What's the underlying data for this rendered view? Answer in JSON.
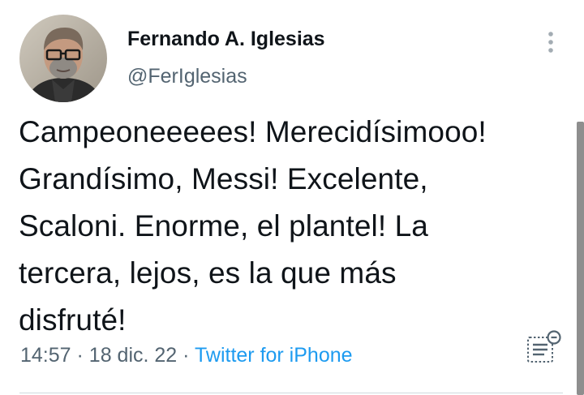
{
  "tweet": {
    "author": {
      "display_name": "Fernando A. Iglesias",
      "handle": "@FerIglesias",
      "avatar_icon": "profile-photo"
    },
    "text": "Campeoneeeees! Merecidísimooo!\nGrandísimo, Messi! Excelente,\nScaloni. Enorme, el plantel! La\ntercera, lejos, es la que más\ndisfruté!",
    "time": "14:57",
    "separator": "·",
    "date": "18 dic. 22",
    "source": "Twitter for iPhone",
    "more_icon": "vertical-ellipsis-icon",
    "analytics_icon": "view-analytics-icon"
  },
  "colors": {
    "primary_text": "#0f1419",
    "secondary_text": "#536471",
    "link": "#1d9bf0"
  }
}
